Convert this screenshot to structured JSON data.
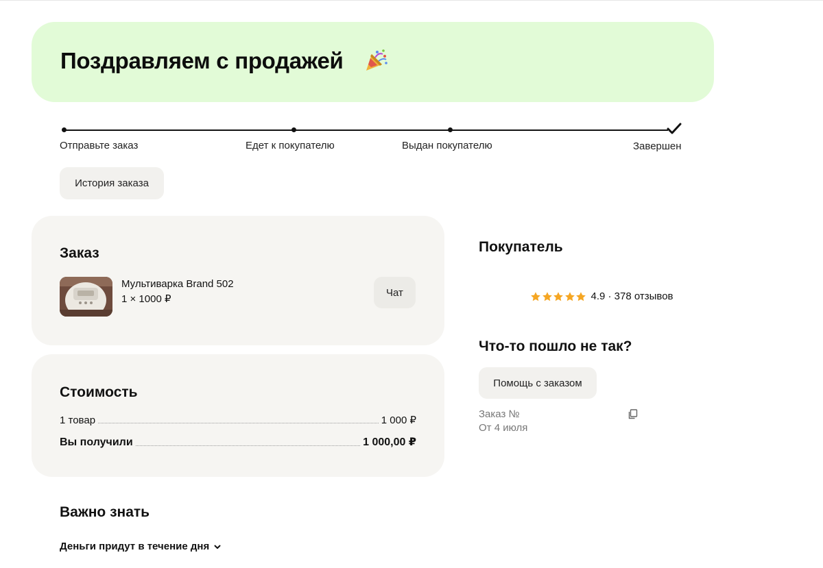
{
  "banner": {
    "title": "Поздравляем с продажей",
    "icon": "party-popper-icon"
  },
  "progress": {
    "steps": [
      {
        "label": "Отправьте заказ"
      },
      {
        "label": "Едет к покупателю"
      },
      {
        "label": "Выдан покупателю"
      },
      {
        "label": "Завершен"
      }
    ],
    "current_step": 4
  },
  "history_button": {
    "label": "История заказа"
  },
  "order": {
    "title": "Заказ",
    "item": {
      "name": "Мультиварка Brand 502",
      "qty": "1 × 1000 ₽"
    },
    "chat_button": "Чат"
  },
  "cost": {
    "title": "Стоимость",
    "rows": [
      {
        "label": "1 товар",
        "value": "1 000 ₽"
      },
      {
        "label": "Вы получили",
        "value": "1 000,00 ₽"
      }
    ]
  },
  "buyer": {
    "title": "Покупатель",
    "rating": {
      "stars": 5,
      "text": "4.9 · 378 отзывов"
    }
  },
  "problem": {
    "title": "Что-то пошло не так?",
    "help_button": "Помощь с заказом",
    "order_number_label": "Заказ №",
    "order_date": "От 4 июля"
  },
  "important": {
    "title": "Важно знать",
    "money_toggle": "Деньги придут в течение дня"
  },
  "colors": {
    "banner_bg": "#e2fbd7",
    "card_bg": "#f6f5f2",
    "star": "#f5a623"
  }
}
